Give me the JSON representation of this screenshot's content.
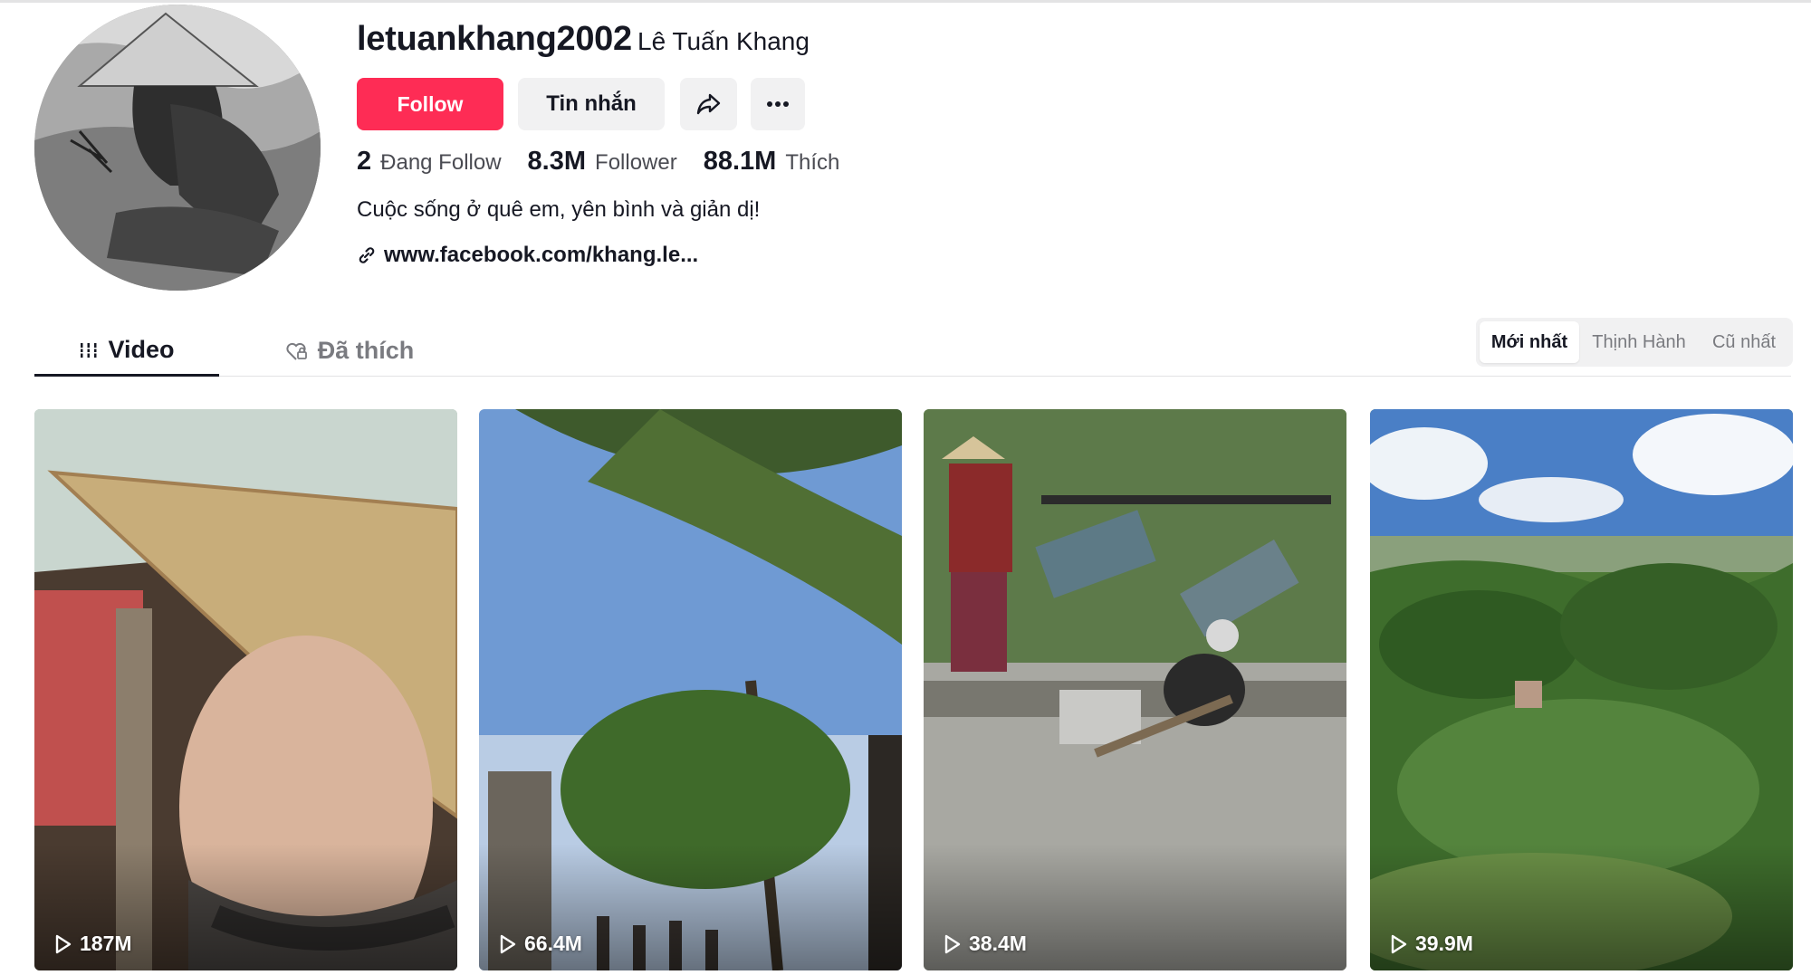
{
  "profile": {
    "username": "letuankhang2002",
    "nickname": "Lê Tuấn Khang",
    "bio": "Cuộc sống ở quê em, yên bình và giản dị!",
    "link": "www.facebook.com/khang.le..."
  },
  "actions": {
    "follow": "Follow",
    "message": "Tin nhắn"
  },
  "stats": [
    {
      "value": "2",
      "label": "Đang Follow"
    },
    {
      "value": "8.3M",
      "label": "Follower"
    },
    {
      "value": "88.1M",
      "label": "Thích"
    }
  ],
  "tabs": {
    "video": "Video",
    "liked": "Đã thích"
  },
  "sort": {
    "latest": "Mới nhất",
    "popular": "Thịnh Hành",
    "oldest": "Cũ nhất"
  },
  "videos": [
    {
      "views": "187M"
    },
    {
      "views": "66.4M"
    },
    {
      "views": "38.4M"
    },
    {
      "views": "39.9M"
    }
  ],
  "colors": {
    "accent": "#fe2c55",
    "button_bg": "#f1f1f2",
    "text": "#161823"
  }
}
